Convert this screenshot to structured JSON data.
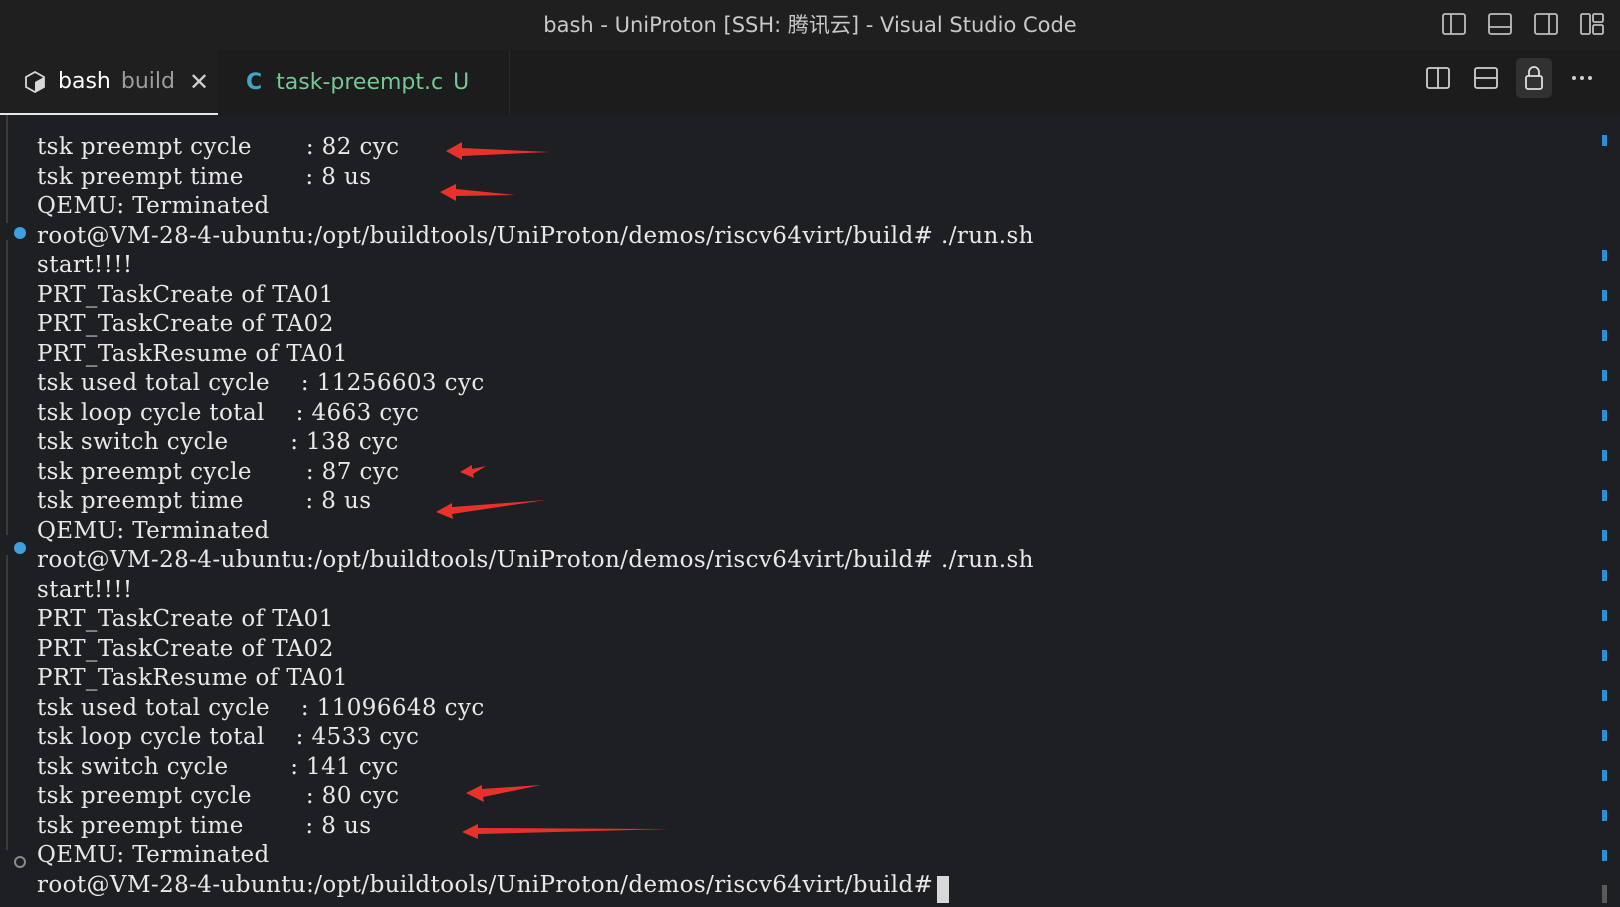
{
  "window": {
    "title": "bash - UniProton [SSH: 腾讯云] - Visual Studio Code"
  },
  "titlebar_icons": [
    "toggle-primary-sidebar-icon",
    "toggle-panel-icon",
    "toggle-secondary-sidebar-icon",
    "customize-layout-icon"
  ],
  "tabs": [
    {
      "label": "bash",
      "sublabel": "build",
      "close": "✕",
      "icon": "terminal-bash-icon",
      "active": true
    },
    {
      "label": "task-preempt.c",
      "lang": "C",
      "badge": "U",
      "active": false
    }
  ],
  "tab_actions": [
    "split-editor-right-icon",
    "split-editor-down-icon",
    "lock-icon",
    "more-actions-icon"
  ],
  "terminal": {
    "lines": [
      "tsk preempt cycle       : 82 cyc",
      "tsk preempt time        : 8 us",
      "QEMU: Terminated",
      "root@VM-28-4-ubuntu:/opt/buildtools/UniProton/demos/riscv64virt/build# ./run.sh",
      "start!!!!",
      "PRT_TaskCreate of TA01",
      "PRT_TaskCreate of TA02",
      "PRT_TaskResume of TA01",
      "tsk used total cycle    : 11256603 cyc",
      "tsk loop cycle total    : 4663 cyc",
      "tsk switch cycle        : 138 cyc",
      "tsk preempt cycle       : 87 cyc",
      "tsk preempt time        : 8 us",
      "QEMU: Terminated",
      "root@VM-28-4-ubuntu:/opt/buildtools/UniProton/demos/riscv64virt/build# ./run.sh",
      "start!!!!",
      "PRT_TaskCreate of TA01",
      "PRT_TaskCreate of TA02",
      "PRT_TaskResume of TA01",
      "tsk used total cycle    : 11096648 cyc",
      "tsk loop cycle total    : 4533 cyc",
      "tsk switch cycle        : 141 cyc",
      "tsk preempt cycle       : 80 cyc",
      "tsk preempt time        : 8 us",
      "QEMU: Terminated",
      "root@VM-28-4-ubuntu:/opt/buildtools/UniProton/demos/riscv64virt/build# "
    ]
  },
  "colors": {
    "terminal_bg": "#1e1f22",
    "arrow": "#e8312b",
    "command_dot": "#3fa0e0",
    "tab_c_text": "#73c991"
  }
}
